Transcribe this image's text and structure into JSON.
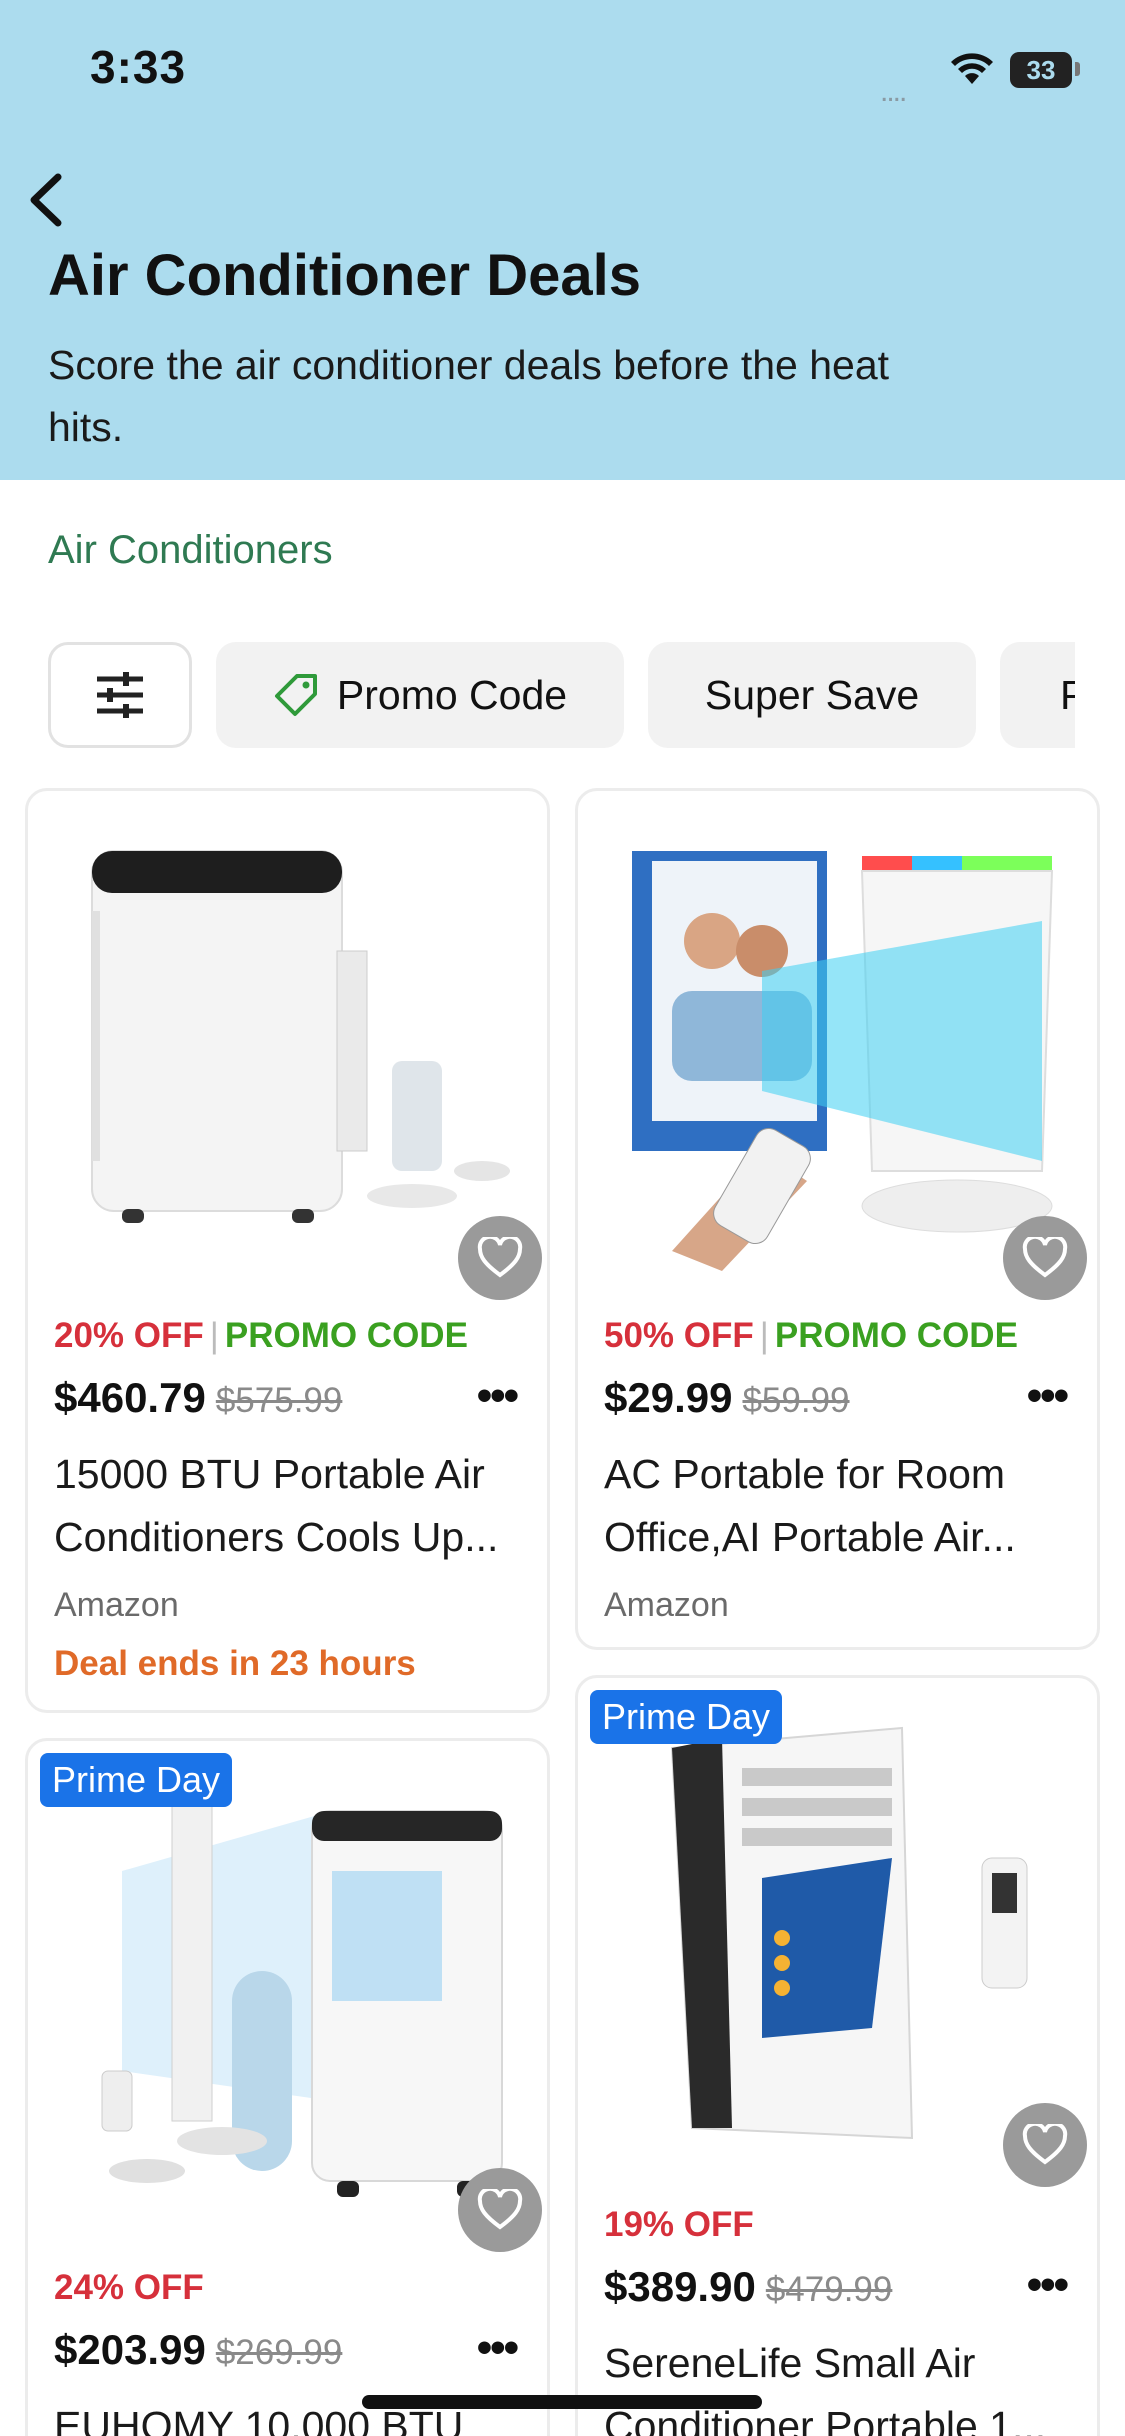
{
  "status_bar": {
    "time": "3:33",
    "signal": "....",
    "battery": "33"
  },
  "header": {
    "back_icon": "chevron-left-icon",
    "title": "Air Conditioner Deals",
    "subtitle": "Score the air conditioner deals before the heat hits."
  },
  "section": {
    "title": "Air Conditioners"
  },
  "filters": {
    "filter_icon": "sliders-icon",
    "chips": [
      {
        "label": "Promo Code",
        "icon": "tag-icon"
      },
      {
        "label": "Super Save"
      },
      {
        "label": "P"
      }
    ]
  },
  "products": [
    {
      "image": "portable-ac-white-image",
      "badge": "",
      "discount": "20% OFF",
      "promo": "PROMO CODE",
      "price": "$460.79",
      "old_price": "$575.99",
      "title": "15000 BTU Portable Air Conditioners Cools Up...",
      "store": "Amazon",
      "deal_ends": "Deal ends in 23 hours"
    },
    {
      "image": "air-cooler-rgb-image",
      "badge": "",
      "discount": "50% OFF",
      "promo": "PROMO CODE",
      "price": "$29.99",
      "old_price": "$59.99",
      "title": "AC Portable for Room Office,AI Portable Air...",
      "store": "Amazon",
      "deal_ends": ""
    },
    {
      "image": "euhomy-ac-image",
      "badge": "Prime Day",
      "discount": "24% OFF",
      "promo": "",
      "price": "$203.99",
      "old_price": "$269.99",
      "title": "EUHOMY 10,000 BTU",
      "store": "",
      "deal_ends": ""
    },
    {
      "image": "serenelife-ac-image",
      "badge": "Prime Day",
      "discount": "19% OFF",
      "promo": "",
      "price": "$389.90",
      "old_price": "$479.99",
      "title": "SereneLife Small Air Conditioner Portable 1...",
      "store": "",
      "deal_ends": ""
    }
  ],
  "colors": {
    "header_bg": "#acdcee",
    "section_green": "#2f7a52",
    "discount_red": "#d6303b",
    "promo_green": "#3aa020",
    "deal_orange": "#e06a28",
    "badge_blue": "#1a73e8"
  }
}
